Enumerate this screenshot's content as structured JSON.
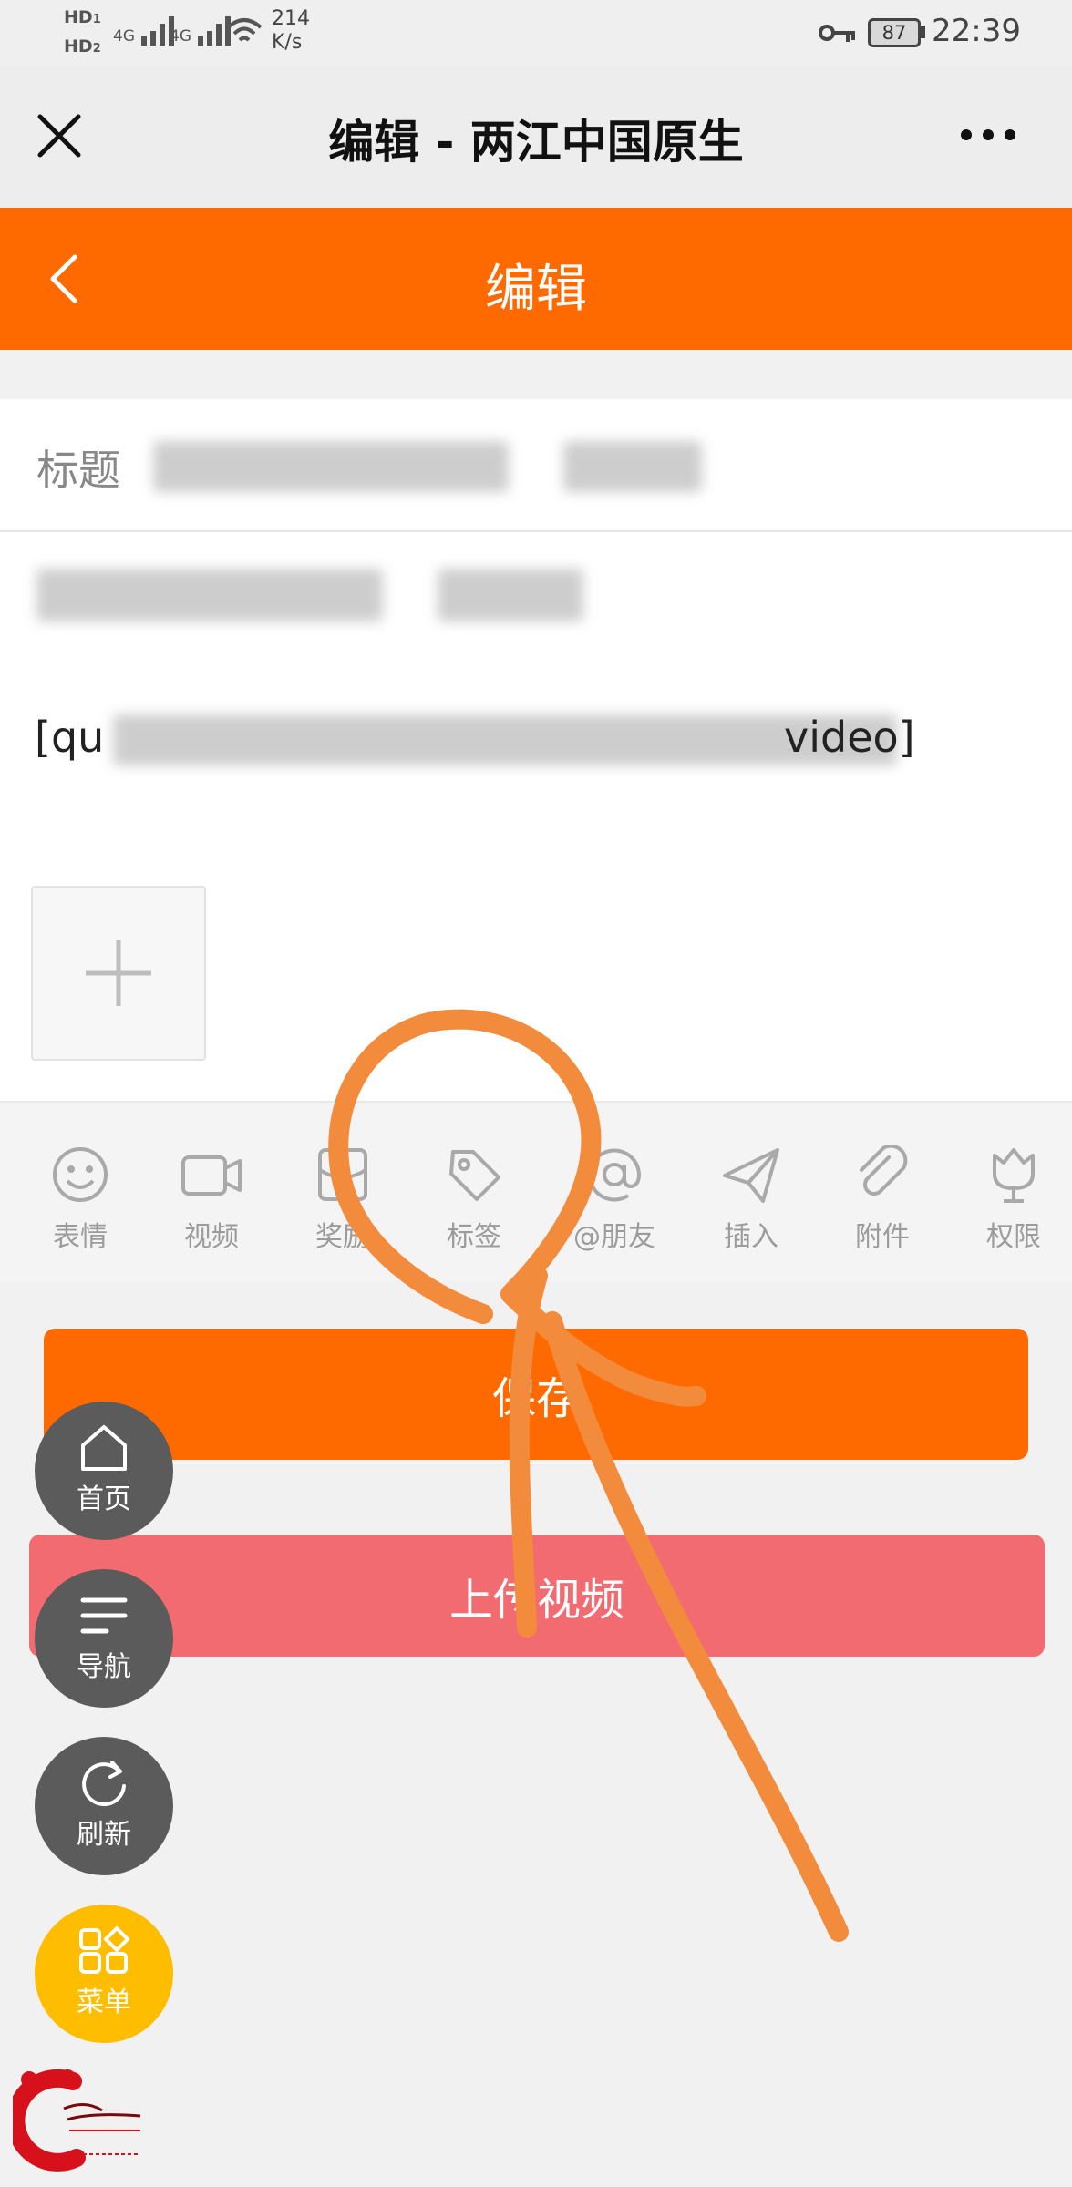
{
  "status_bar": {
    "hd1": "HD",
    "hd1_sub": "1",
    "hd2": "HD",
    "hd2_sub": "2",
    "signal1": "4G",
    "signal2": "4G",
    "speed_value": "214",
    "speed_unit": "K/s",
    "battery": "87",
    "time": "22:39"
  },
  "wechat_bar": {
    "title": "编辑 - 两江中国原生"
  },
  "header": {
    "title": "编辑"
  },
  "form": {
    "title_label": "标题",
    "content_line2_prefix": "[qu",
    "content_line2_suffix": "video]"
  },
  "toolbar": {
    "items": [
      {
        "label": "表情",
        "icon": "smile-icon"
      },
      {
        "label": "视频",
        "icon": "video-icon"
      },
      {
        "label": "奖励",
        "icon": "reward-icon"
      },
      {
        "label": "标签",
        "icon": "tag-icon"
      },
      {
        "label": "@朋友",
        "icon": "at-icon"
      },
      {
        "label": "插入",
        "icon": "send-icon"
      },
      {
        "label": "附件",
        "icon": "paperclip-icon"
      },
      {
        "label": "权限",
        "icon": "tulip-icon"
      }
    ]
  },
  "buttons": {
    "save": "保存",
    "upload_video": "上传视频"
  },
  "fabs": {
    "home": "首页",
    "nav": "导航",
    "refresh": "刷新",
    "menu": "菜单"
  },
  "colors": {
    "accent": "#ff6a00",
    "upload": "#f26b71",
    "fab_gray": "#5b5b5b",
    "fab_menu": "#ffbd00",
    "annotation": "#f28b3c"
  }
}
